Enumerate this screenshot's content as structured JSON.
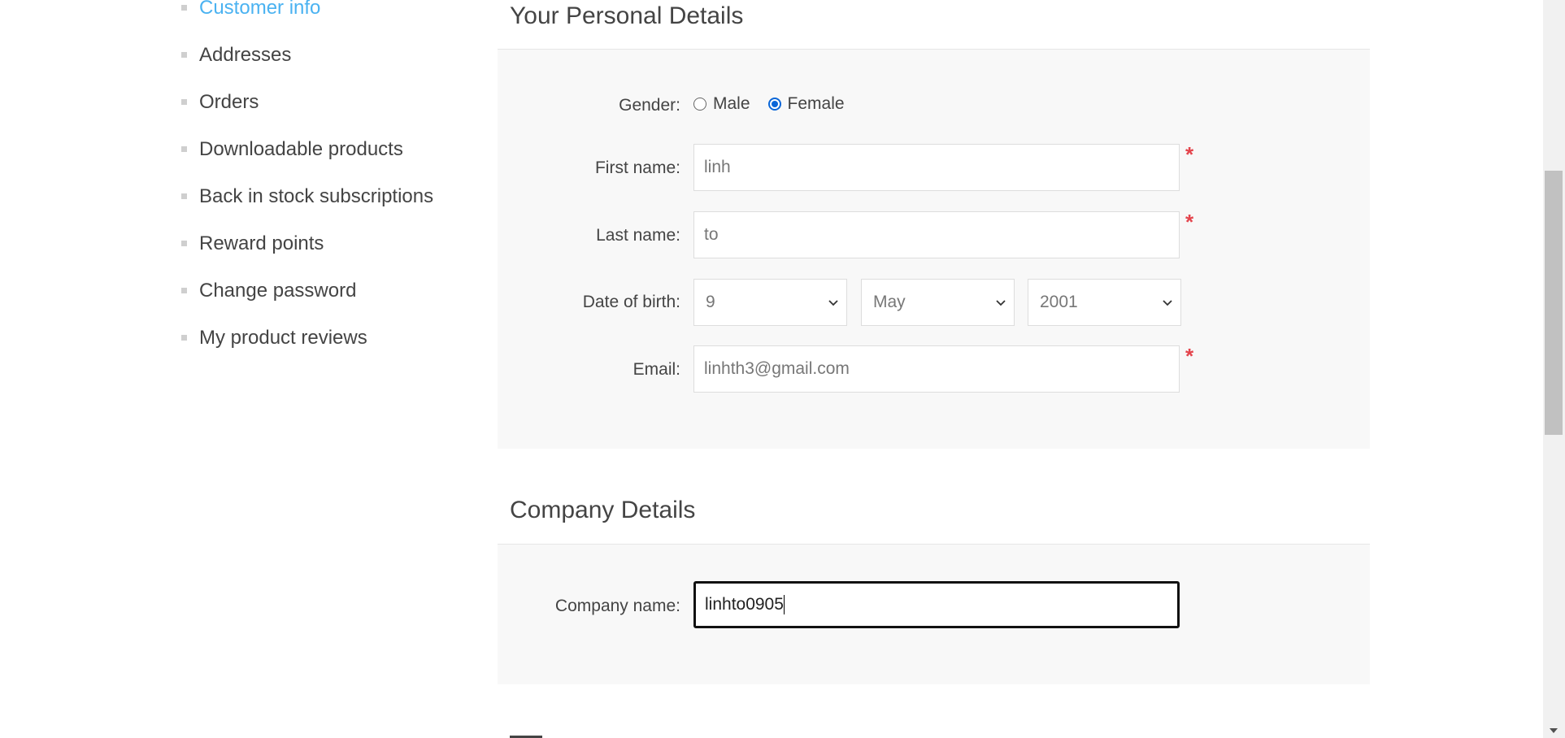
{
  "sidebar": {
    "items": [
      {
        "label": "Customer info",
        "active": true
      },
      {
        "label": "Addresses"
      },
      {
        "label": "Orders"
      },
      {
        "label": "Downloadable products"
      },
      {
        "label": "Back in stock subscriptions"
      },
      {
        "label": "Reward points"
      },
      {
        "label": "Change password"
      },
      {
        "label": "My product reviews"
      }
    ]
  },
  "personal": {
    "title": "Your Personal Details",
    "gender_label": "Gender:",
    "gender_options": [
      "Male",
      "Female"
    ],
    "gender_selected": "Female",
    "first_name_label": "First name:",
    "first_name_value": "linh",
    "last_name_label": "Last name:",
    "last_name_value": "to",
    "dob_label": "Date of birth:",
    "dob_day": "9",
    "dob_month": "May",
    "dob_year": "2001",
    "email_label": "Email:",
    "email_value": "linhth3@gmail.com",
    "required_mark": "*"
  },
  "company": {
    "title": "Company Details",
    "company_name_label": "Company name:",
    "company_name_value": "linhto0905"
  },
  "colors": {
    "active_link": "#4ab2f1",
    "required": "#e4444c",
    "radio_checked": "#0a66d8",
    "panel_bg": "#f8f8f8"
  }
}
